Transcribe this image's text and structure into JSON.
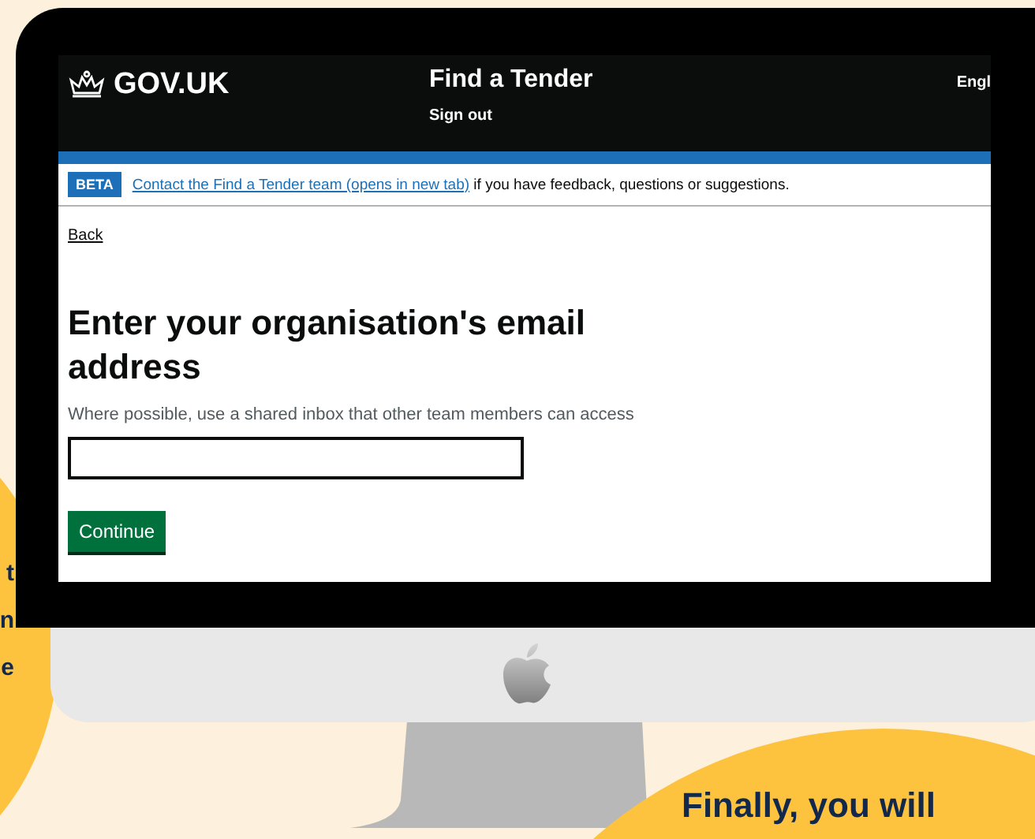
{
  "side_bubble": {
    "lines": [
      "t",
      "n",
      "e"
    ]
  },
  "screen": {
    "header": {
      "logo": "GOV.UK",
      "service": "Find a Tender",
      "sign_out": "Sign out",
      "language": "Engl"
    },
    "banner": {
      "tag": "BETA",
      "link": "Contact the Find a Tender team (opens in new tab)",
      "text": " if you have feedback, questions or suggestions."
    },
    "back_link": "Back",
    "heading": "Enter your organisation's email address",
    "hint": "Where possible, use a shared inbox that other team members can access",
    "button": "Continue"
  },
  "bottom_bubble": {
    "text": "Finally, you will"
  }
}
